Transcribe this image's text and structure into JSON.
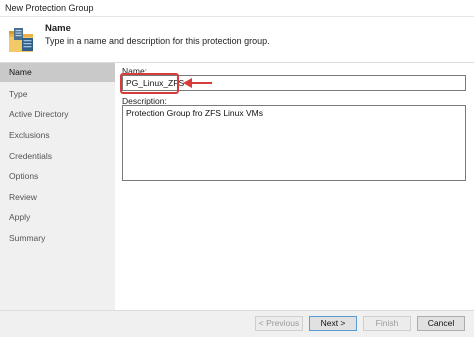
{
  "window": {
    "title": "New Protection Group"
  },
  "header": {
    "title": "Name",
    "description": "Type in a name and description for this protection group.",
    "icon": "protection-group-folder-icon"
  },
  "sidebar": {
    "items": [
      {
        "label": "Name",
        "active": true
      },
      {
        "label": "Type",
        "active": false
      },
      {
        "label": "Active Directory",
        "active": false
      },
      {
        "label": "Exclusions",
        "active": false
      },
      {
        "label": "Credentials",
        "active": false
      },
      {
        "label": "Options",
        "active": false
      },
      {
        "label": "Review",
        "active": false
      },
      {
        "label": "Apply",
        "active": false
      },
      {
        "label": "Summary",
        "active": false
      }
    ]
  },
  "form": {
    "name_label": "Name:",
    "name_value": "PG_Linux_ZFS",
    "description_label": "Description:",
    "description_value": "Protection Group fro ZFS Linux VMs"
  },
  "annotation": {
    "highlight_color": "#d83b3b",
    "arrow_color": "#d83b3b"
  },
  "footer": {
    "previous_label": "< Previous",
    "next_label": "Next >",
    "finish_label": "Finish",
    "cancel_label": "Cancel"
  }
}
